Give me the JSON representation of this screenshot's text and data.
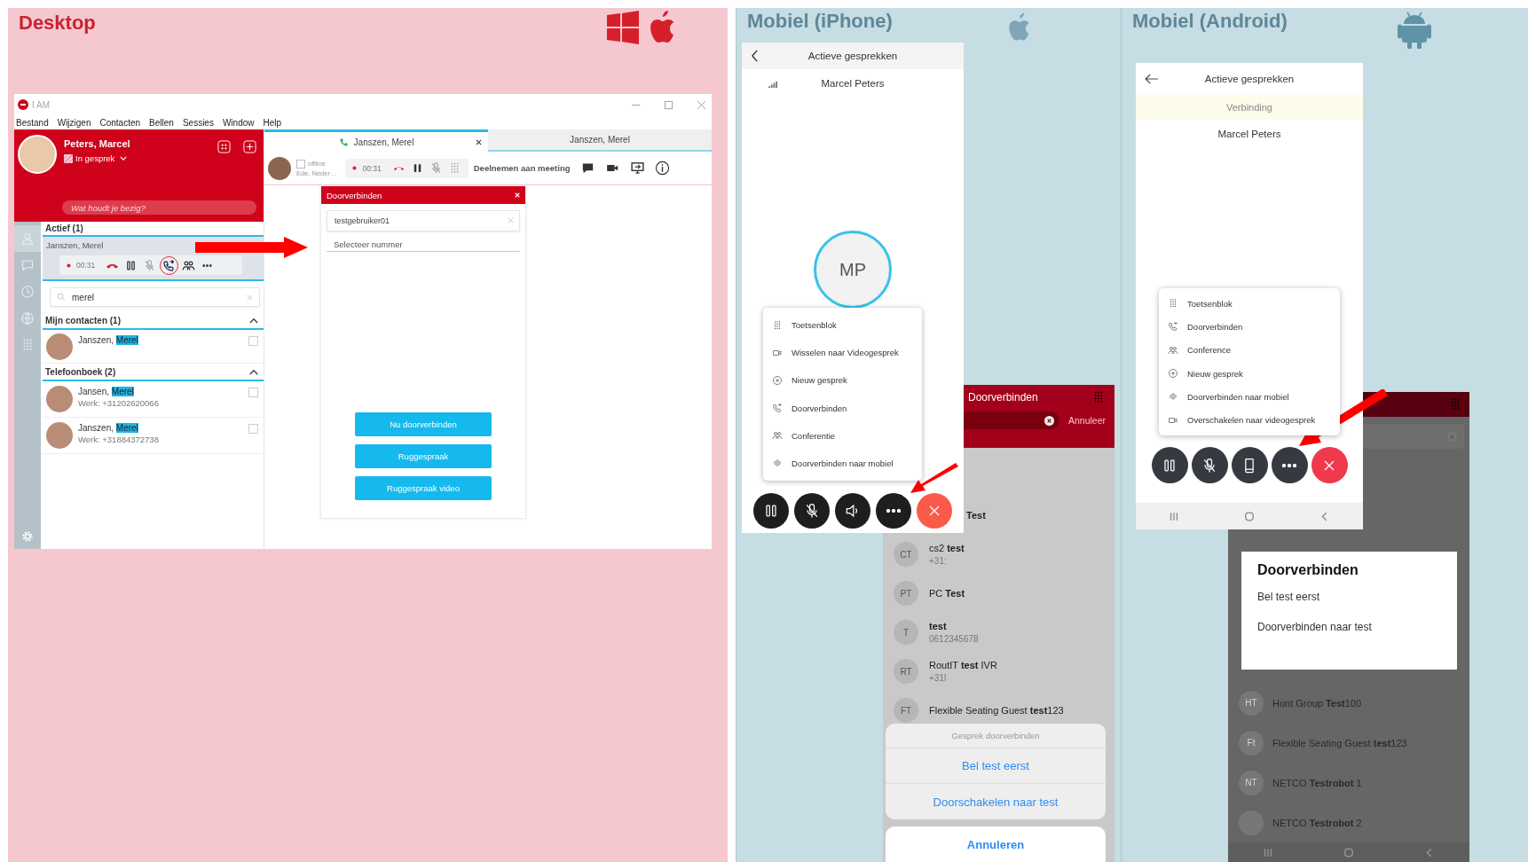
{
  "desktop": {
    "heading": "Desktop",
    "app": {
      "title": "I AM",
      "menu": [
        "Bestand",
        "Wijzigen",
        "Contacten",
        "Bellen",
        "Sessies",
        "Window",
        "Help"
      ],
      "profile": {
        "name": "Peters, Marcel",
        "status": "In gesprek",
        "mood_placeholder": "Wat houdt je bezig?"
      },
      "sidebar": [
        {
          "kind": "contacts",
          "selected": true
        },
        {
          "kind": "chat",
          "selected": false
        },
        {
          "kind": "history",
          "selected": false
        },
        {
          "kind": "globe",
          "selected": false
        },
        {
          "kind": "keypad",
          "selected": false
        }
      ],
      "active": {
        "header": "Actief (1)",
        "name": "Janszen, Merel",
        "timer": "00:31",
        "controls": [
          {
            "kind": "hangup",
            "annotated": false
          },
          {
            "kind": "pause",
            "annotated": false
          },
          {
            "kind": "mute",
            "annotated": false
          },
          {
            "kind": "transfer",
            "annotated": true
          },
          {
            "kind": "conference",
            "annotated": false
          },
          {
            "kind": "more",
            "annotated": false
          }
        ]
      },
      "search": {
        "value": "merel"
      },
      "groups": [
        {
          "title": "Mijn contacten (1)",
          "expanded": true,
          "contacts": [
            {
              "name": "Janszen,",
              "match": "Merel",
              "checked": false
            }
          ]
        },
        {
          "title": "Telefoonboek (2)",
          "expanded": true,
          "contacts": [
            {
              "name": "Jansen,",
              "match": "Merel",
              "phone": "Werk: +31202620066",
              "checked": false
            },
            {
              "name": "Janszen,",
              "match": "Merel",
              "phone": "Werk: +31884372738",
              "checked": false
            }
          ]
        }
      ],
      "tabs": [
        {
          "label": "Janszen, Merel",
          "selected": true
        },
        {
          "label": "Janszen, Merel",
          "selected": false
        }
      ],
      "contact_bar": {
        "presence": "offline",
        "location": "Ede, Neder…",
        "timer": "00:31",
        "meeting": "Deelnemen aan meeting"
      },
      "dialog": {
        "title": "Doorverbinden",
        "value": "testgebruiker01",
        "select_placeholder": "Selecteer nummer",
        "buttons": [
          "Nu doorverbinden",
          "Ruggespraak",
          "Ruggespraak video"
        ]
      }
    }
  },
  "iphone": {
    "heading": "Mobiel (iPhone)",
    "call": {
      "title": "Actieve gesprekken",
      "caller": "Marcel Peters",
      "initials": "MP",
      "menu": [
        {
          "kind": "keypad",
          "label": "Toetsenblok"
        },
        {
          "kind": "video",
          "label": "Wisselen naar Videogesprek"
        },
        {
          "kind": "new",
          "label": "Nieuw gesprek"
        },
        {
          "kind": "transfer",
          "label": "Doorverbinden"
        },
        {
          "kind": "conference",
          "label": "Conferentie"
        },
        {
          "kind": "mobile",
          "label": "Doorverbinden naar mobiel"
        }
      ],
      "controls": [
        {
          "kind": "pause"
        },
        {
          "kind": "mute"
        },
        {
          "kind": "speaker"
        },
        {
          "kind": "more"
        },
        {
          "kind": "end"
        }
      ]
    },
    "transfer": {
      "title": "Doorverbinden",
      "cancel": "Annuleer",
      "contacts": [
        {
          "kind": "partial",
          "name": "Test"
        },
        {
          "kind": "contact",
          "initials": "CT",
          "name": "cs2 **test**",
          "phone": "+31:"
        },
        {
          "kind": "contact",
          "initials": "PT",
          "name": "PC **Test**"
        },
        {
          "kind": "exact",
          "initials": "T",
          "name": "test",
          "phone": "0612345678"
        },
        {
          "kind": "contact",
          "initials": "RT",
          "name": "RoutIT **test** IVR",
          "phone": "+31l"
        },
        {
          "kind": "contact",
          "initials": "FT",
          "name": "Flexible Seating Guest **test**123"
        }
      ],
      "sheet": {
        "title": "Gesprek doorverbinden",
        "options": [
          "Bel test eerst",
          "Doorschakelen naar test"
        ],
        "cancel": "Annuleren"
      }
    }
  },
  "android": {
    "heading": "Mobiel (Android)",
    "call": {
      "title": "Actieve gesprekken",
      "banner": "Verbinding",
      "caller": "Marcel Peters",
      "menu": [
        {
          "kind": "keypad",
          "label": "Toetsenblok"
        },
        {
          "kind": "transfer",
          "label": "Doorverbinden"
        },
        {
          "kind": "conference",
          "label": "Conference"
        },
        {
          "kind": "new",
          "label": "Nieuw gesprek"
        },
        {
          "kind": "mobile",
          "label": "Doorverbinden naar mobiel"
        },
        {
          "kind": "video",
          "label": "Overschakelen naar videogesprek"
        }
      ],
      "controls": [
        {
          "kind": "pause"
        },
        {
          "kind": "mute"
        },
        {
          "kind": "device"
        },
        {
          "kind": "more"
        },
        {
          "kind": "end"
        }
      ]
    },
    "transfer": {
      "contacts": [
        {
          "initials": "HT",
          "name": "Hunt Group **Test**100"
        },
        {
          "initials": "Ft",
          "name": "Flexible Seating Guest **test**123"
        },
        {
          "initials": "NT",
          "name": "NETCO **Testrobot** 1"
        },
        {
          "name": "NETCO **Testrobot** 2"
        }
      ],
      "dialog": {
        "title": "Doorverbinden",
        "options": [
          "Bel test eerst",
          "Doorverbinden naar test"
        ]
      }
    }
  }
}
